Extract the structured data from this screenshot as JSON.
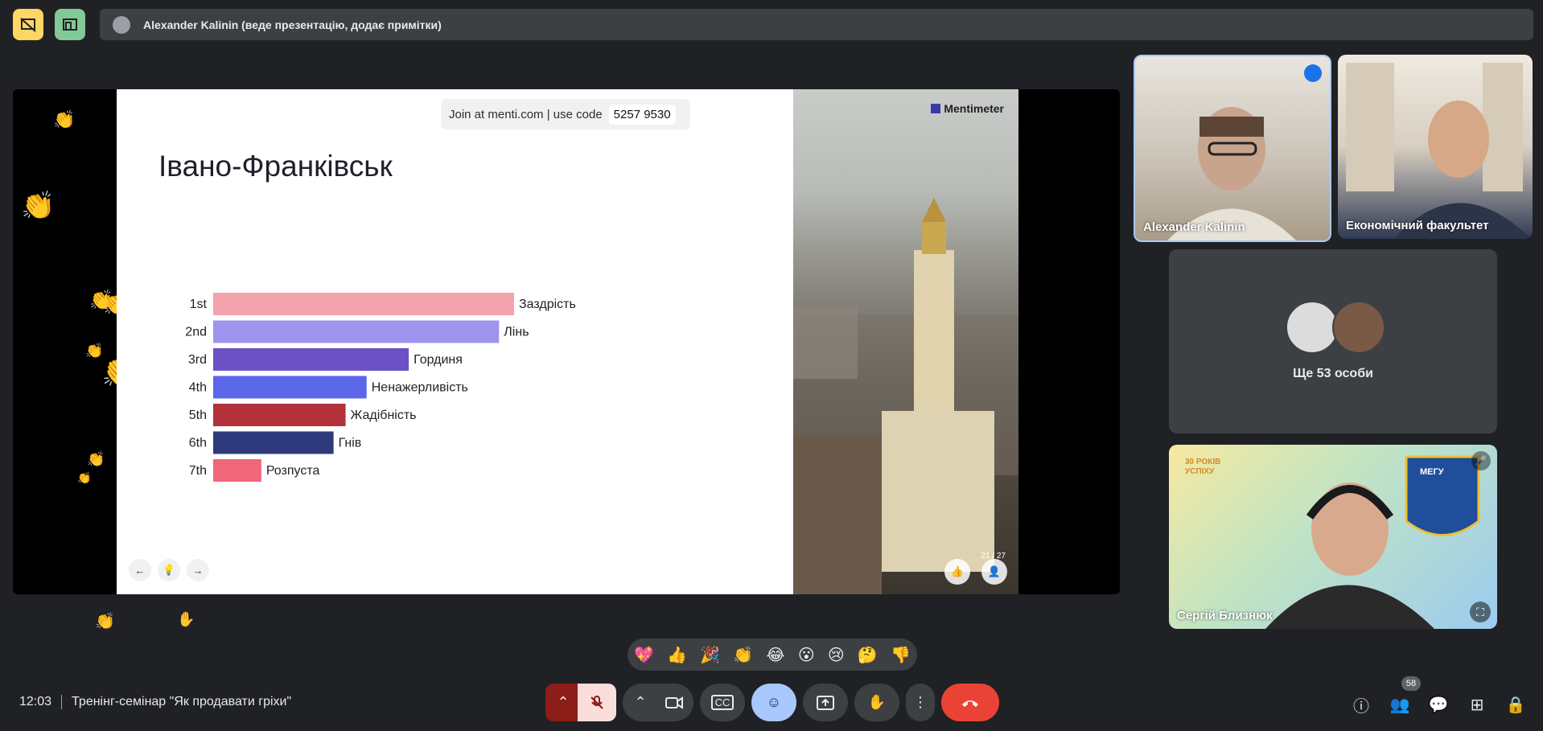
{
  "presenter_bar": {
    "text": "Alexander Kalinin (веде презентацію, додає примітки)"
  },
  "slide": {
    "join_text": "Join at menti.com | use code",
    "join_code": "5257 9530",
    "brand": "Mentimeter",
    "title": "Івано-Франківськ",
    "counter": "21 / 27"
  },
  "chart_data": {
    "type": "bar",
    "categories": [
      "1st",
      "2nd",
      "3rd",
      "4th",
      "5th",
      "6th",
      "7th"
    ],
    "labels": [
      "Заздрість",
      "Лінь",
      "Гординя",
      "Ненажерливість",
      "Жадібність",
      "Гнів",
      "Розпуста"
    ],
    "values": [
      100,
      95,
      65,
      51,
      44,
      40,
      16
    ],
    "colors": [
      "#f3a3ab",
      "#9e94ee",
      "#6a52c4",
      "#5b67e8",
      "#b2313b",
      "#2e3a7c",
      "#f0667a"
    ],
    "ylim": [
      0,
      100
    ]
  },
  "tiles": {
    "speaker": {
      "name": "Alexander Kalinin"
    },
    "faculty": {
      "name": "Економічний факультет"
    },
    "more": {
      "label": "Ще 53 особи"
    },
    "participant": {
      "name": "Сергій Близнюк",
      "logo_text": "МЕГУ",
      "years_text": "30 РОКІВ УСПІХУ"
    }
  },
  "reactions": [
    "💖",
    "👍",
    "🎉",
    "👏",
    "😂",
    "😮",
    "😢",
    "🤔",
    "👎"
  ],
  "meeting": {
    "time": "12:03",
    "title": "Тренінг-семінар \"Як продавати гріхи\""
  },
  "people_count": "58",
  "colors": {
    "accent": "#8ab4f8",
    "end_call": "#ea4335",
    "mic_off": "#f9dedc"
  }
}
